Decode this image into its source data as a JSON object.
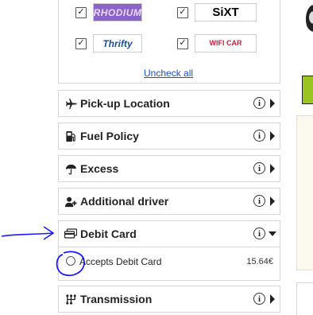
{
  "suppliers": {
    "items": [
      {
        "name": "RHODIUM",
        "checked": true
      },
      {
        "name": "SiXT",
        "checked": true
      },
      {
        "name": "Thrifty",
        "checked": true
      },
      {
        "name": "WIFI CAR",
        "checked": true
      }
    ],
    "uncheck_all": "Uncheck all"
  },
  "sections": [
    {
      "label": "Pick-up Location",
      "icon": "plane-icon"
    },
    {
      "label": "Fuel Policy",
      "icon": "fuel-pump-icon"
    },
    {
      "label": "Excess",
      "icon": "umbrella-icon"
    },
    {
      "label": "Additional driver",
      "icon": "add-user-icon"
    },
    {
      "label": "Debit Card",
      "icon": "debit-card-icon",
      "expanded": true
    },
    {
      "label": "Transmission",
      "icon": "gearbox-icon"
    }
  ],
  "debit_card_option": {
    "label": "Accepts Debit Card",
    "price": "15.64€",
    "selected": false
  },
  "info_glyph": "i",
  "check_glyph": "✓",
  "colors": {
    "annotation": "#1a1aff",
    "rhodium_bg": "#8b63c9",
    "thrifty_text": "#1b4d9c",
    "wificar_text": "#c41e3a",
    "green_badge": "#9ac421"
  }
}
